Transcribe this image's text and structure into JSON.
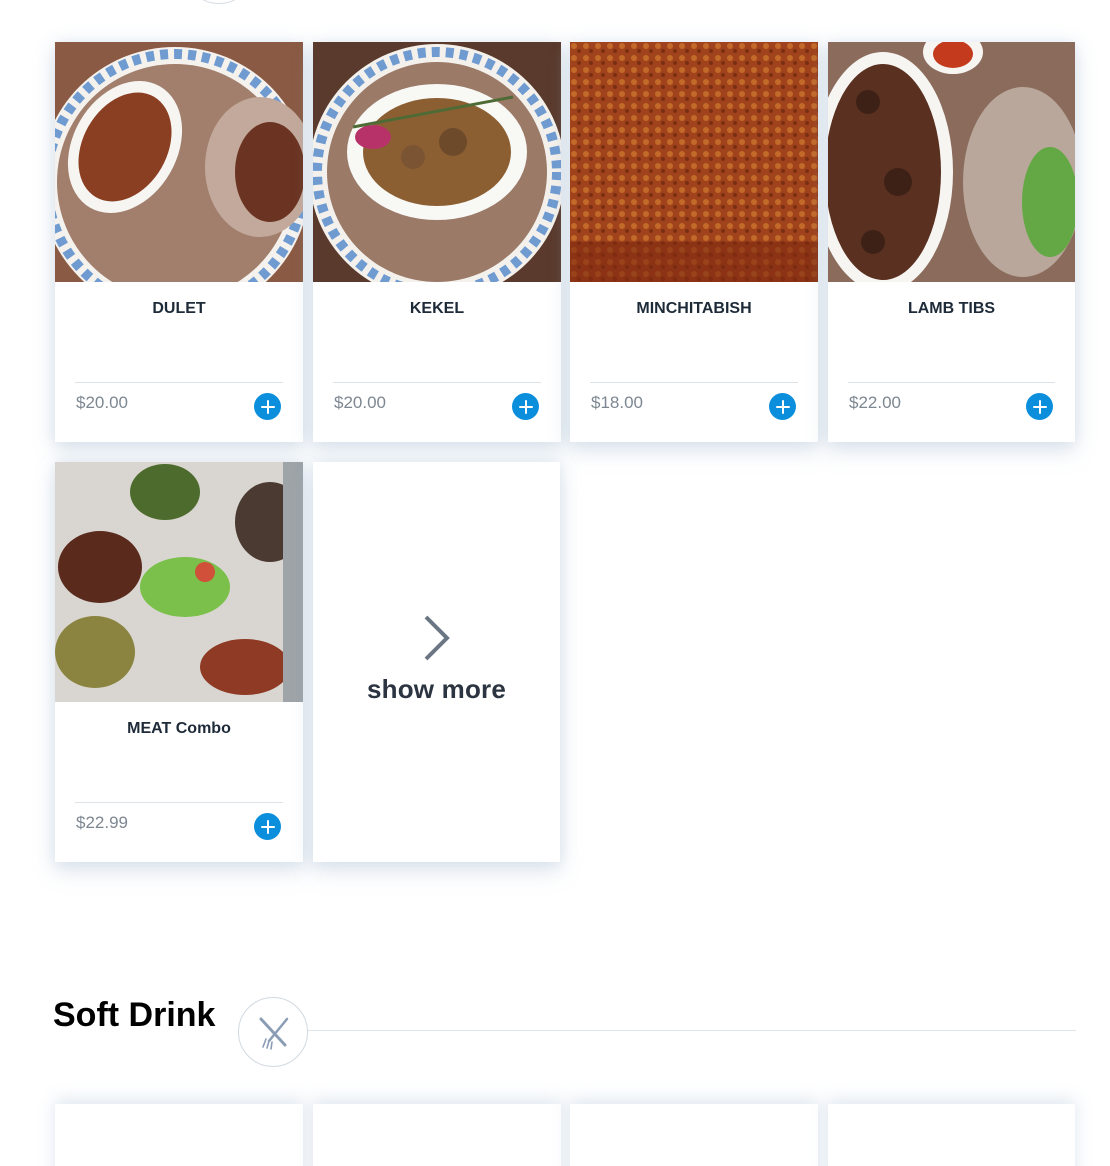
{
  "menu_items": [
    {
      "name": "DULET",
      "price": "$20.00"
    },
    {
      "name": "KEKEL",
      "price": "$20.00"
    },
    {
      "name": "MINCHITABISH",
      "price": "$18.00"
    },
    {
      "name": "LAMB TIBS",
      "price": "$22.00"
    },
    {
      "name": "MEAT Combo",
      "price": "$22.99"
    }
  ],
  "show_more_label": "show more",
  "next_section": {
    "title": "Soft Drink",
    "icon": "utensils-icon"
  },
  "colors": {
    "accent": "#0b8fdc",
    "title": "#1d2a38",
    "price": "#7d8791"
  }
}
